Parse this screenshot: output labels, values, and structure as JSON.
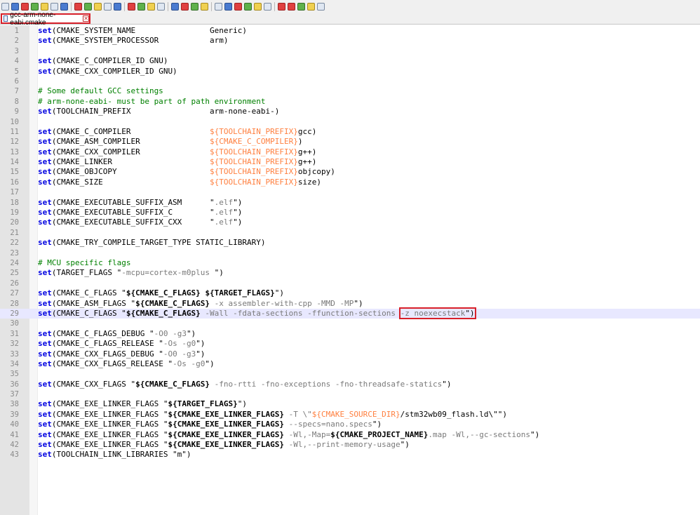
{
  "toolbar": {
    "icons": [
      "new-file-icon",
      "open-file-icon",
      "save-icon",
      "save-all-icon",
      "close-icon",
      "close-all-icon",
      "print-icon",
      "cut-icon",
      "copy-icon",
      "paste-icon",
      "undo-icon",
      "redo-icon",
      "find-icon",
      "replace-icon",
      "zoom-in-icon",
      "zoom-out-icon",
      "sync-vertical-icon",
      "sync-horizontal-icon",
      "word-wrap-icon",
      "show-all-chars-icon",
      "indent-guide-icon",
      "user-language-icon",
      "doc-map-icon",
      "function-list-icon",
      "folder-workspace-icon",
      "monitoring-icon",
      "record-macro-icon",
      "stop-macro-icon",
      "play-macro-icon",
      "run-macro-icon",
      "save-macro-icon"
    ]
  },
  "tab": {
    "label": "gcc-arm-none-eabi.cmake",
    "close": "✕"
  },
  "editor": {
    "current_line": 29,
    "lines": [
      [
        [
          "kw",
          "set"
        ],
        [
          "t",
          "(CMAKE_SYSTEM_NAME                Generic)"
        ]
      ],
      [
        [
          "kw",
          "set"
        ],
        [
          "t",
          "(CMAKE_SYSTEM_PROCESSOR           arm)"
        ]
      ],
      [],
      [
        [
          "kw",
          "set"
        ],
        [
          "t",
          "(CMAKE_C_COMPILER_ID GNU)"
        ]
      ],
      [
        [
          "kw",
          "set"
        ],
        [
          "t",
          "(CMAKE_CXX_COMPILER_ID GNU)"
        ]
      ],
      [],
      [
        [
          "cm",
          "# Some default GCC settings"
        ]
      ],
      [
        [
          "cm",
          "# arm-none-eabi- must be part of path environment"
        ]
      ],
      [
        [
          "kw",
          "set"
        ],
        [
          "t",
          "(TOOLCHAIN_PREFIX                 arm-none-eabi-)"
        ]
      ],
      [],
      [
        [
          "kw",
          "set"
        ],
        [
          "t",
          "(CMAKE_C_COMPILER                 "
        ],
        [
          "var",
          "${TOOLCHAIN_PREFIX}"
        ],
        [
          "t",
          "gcc)"
        ]
      ],
      [
        [
          "kw",
          "set"
        ],
        [
          "t",
          "(CMAKE_ASM_COMPILER               "
        ],
        [
          "var",
          "${CMAKE_C_COMPILER}"
        ],
        [
          "t",
          ")"
        ]
      ],
      [
        [
          "kw",
          "set"
        ],
        [
          "t",
          "(CMAKE_CXX_COMPILER               "
        ],
        [
          "var",
          "${TOOLCHAIN_PREFIX}"
        ],
        [
          "t",
          "g++)"
        ]
      ],
      [
        [
          "kw",
          "set"
        ],
        [
          "t",
          "(CMAKE_LINKER                     "
        ],
        [
          "var",
          "${TOOLCHAIN_PREFIX}"
        ],
        [
          "t",
          "g++)"
        ]
      ],
      [
        [
          "kw",
          "set"
        ],
        [
          "t",
          "(CMAKE_OBJCOPY                    "
        ],
        [
          "var",
          "${TOOLCHAIN_PREFIX}"
        ],
        [
          "t",
          "objcopy)"
        ]
      ],
      [
        [
          "kw",
          "set"
        ],
        [
          "t",
          "(CMAKE_SIZE                       "
        ],
        [
          "var",
          "${TOOLCHAIN_PREFIX}"
        ],
        [
          "t",
          "size)"
        ]
      ],
      [],
      [
        [
          "kw",
          "set"
        ],
        [
          "t",
          "(CMAKE_EXECUTABLE_SUFFIX_ASM      \""
        ],
        [
          "str",
          ".elf"
        ],
        [
          "t",
          "\")"
        ]
      ],
      [
        [
          "kw",
          "set"
        ],
        [
          "t",
          "(CMAKE_EXECUTABLE_SUFFIX_C        \""
        ],
        [
          "str",
          ".elf"
        ],
        [
          "t",
          "\")"
        ]
      ],
      [
        [
          "kw",
          "set"
        ],
        [
          "t",
          "(CMAKE_EXECUTABLE_SUFFIX_CXX      \""
        ],
        [
          "str",
          ".elf"
        ],
        [
          "t",
          "\")"
        ]
      ],
      [],
      [
        [
          "kw",
          "set"
        ],
        [
          "t",
          "(CMAKE_TRY_COMPILE_TARGET_TYPE STATIC_LIBRARY)"
        ]
      ],
      [],
      [
        [
          "cm",
          "# MCU specific flags"
        ]
      ],
      [
        [
          "kw",
          "set"
        ],
        [
          "t",
          "(TARGET_FLAGS \""
        ],
        [
          "str",
          "-mcpu=cortex-m0plus "
        ],
        [
          "t",
          "\")"
        ]
      ],
      [],
      [
        [
          "kw",
          "set"
        ],
        [
          "t",
          "(CMAKE_C_FLAGS \""
        ],
        [
          "strb",
          "${CMAKE_C_FLAGS}"
        ],
        [
          "t",
          " "
        ],
        [
          "strb",
          "${TARGET_FLAGS}"
        ],
        [
          "t",
          "\")"
        ]
      ],
      [
        [
          "kw",
          "set"
        ],
        [
          "t",
          "(CMAKE_ASM_FLAGS \""
        ],
        [
          "strb",
          "${CMAKE_C_FLAGS}"
        ],
        [
          "str",
          " -x assembler-with-cpp -MMD -MP"
        ],
        [
          "t",
          "\")"
        ]
      ],
      [
        [
          "kw",
          "set"
        ],
        [
          "t",
          "(CMAKE_C_FLAGS \""
        ],
        [
          "strb",
          "${CMAKE_C_FLAGS}"
        ],
        [
          "str",
          " -Wall -fdata-sections -ffunction-sections "
        ],
        [
          "hl",
          "-z noexecstack"
        ],
        [
          "t",
          "\")"
        ]
      ],
      [],
      [
        [
          "kw",
          "set"
        ],
        [
          "t",
          "(CMAKE_C_FLAGS_DEBUG \""
        ],
        [
          "str",
          "-O0 -g3"
        ],
        [
          "t",
          "\")"
        ]
      ],
      [
        [
          "kw",
          "set"
        ],
        [
          "t",
          "(CMAKE_C_FLAGS_RELEASE \""
        ],
        [
          "str",
          "-Os -g0"
        ],
        [
          "t",
          "\")"
        ]
      ],
      [
        [
          "kw",
          "set"
        ],
        [
          "t",
          "(CMAKE_CXX_FLAGS_DEBUG \""
        ],
        [
          "str",
          "-O0 -g3"
        ],
        [
          "t",
          "\")"
        ]
      ],
      [
        [
          "kw",
          "set"
        ],
        [
          "t",
          "(CMAKE_CXX_FLAGS_RELEASE \""
        ],
        [
          "str",
          "-Os -g0"
        ],
        [
          "t",
          "\")"
        ]
      ],
      [],
      [
        [
          "kw",
          "set"
        ],
        [
          "t",
          "(CMAKE_CXX_FLAGS \""
        ],
        [
          "strb",
          "${CMAKE_C_FLAGS}"
        ],
        [
          "str",
          " -fno-rtti -fno-exceptions -fno-threadsafe-statics"
        ],
        [
          "t",
          "\")"
        ]
      ],
      [],
      [
        [
          "kw",
          "set"
        ],
        [
          "t",
          "(CMAKE_EXE_LINKER_FLAGS \""
        ],
        [
          "strb",
          "${TARGET_FLAGS}"
        ],
        [
          "t",
          "\")"
        ]
      ],
      [
        [
          "kw",
          "set"
        ],
        [
          "t",
          "(CMAKE_EXE_LINKER_FLAGS \""
        ],
        [
          "strb",
          "${CMAKE_EXE_LINKER_FLAGS}"
        ],
        [
          "str",
          " -T \\\""
        ],
        [
          "var",
          "${CMAKE_SOURCE_DIR}"
        ],
        [
          "t",
          "/stm32wb09_flash.ld\\\"\")"
        ]
      ],
      [
        [
          "kw",
          "set"
        ],
        [
          "t",
          "(CMAKE_EXE_LINKER_FLAGS \""
        ],
        [
          "strb",
          "${CMAKE_EXE_LINKER_FLAGS}"
        ],
        [
          "str",
          " --specs=nano.specs"
        ],
        [
          "t",
          "\")"
        ]
      ],
      [
        [
          "kw",
          "set"
        ],
        [
          "t",
          "(CMAKE_EXE_LINKER_FLAGS \""
        ],
        [
          "strb",
          "${CMAKE_EXE_LINKER_FLAGS}"
        ],
        [
          "str",
          " -Wl,-Map="
        ],
        [
          "strb",
          "${CMAKE_PROJECT_NAME}"
        ],
        [
          "str",
          ".map -Wl,--gc-sections"
        ],
        [
          "t",
          "\")"
        ]
      ],
      [
        [
          "kw",
          "set"
        ],
        [
          "t",
          "(CMAKE_EXE_LINKER_FLAGS \""
        ],
        [
          "strb",
          "${CMAKE_EXE_LINKER_FLAGS}"
        ],
        [
          "str",
          " -Wl,--print-memory-usage"
        ],
        [
          "t",
          "\")"
        ]
      ],
      [
        [
          "kw",
          "set"
        ],
        [
          "t",
          "(TOOLCHAIN_LINK_LIBRARIES \"m\")"
        ]
      ]
    ]
  }
}
